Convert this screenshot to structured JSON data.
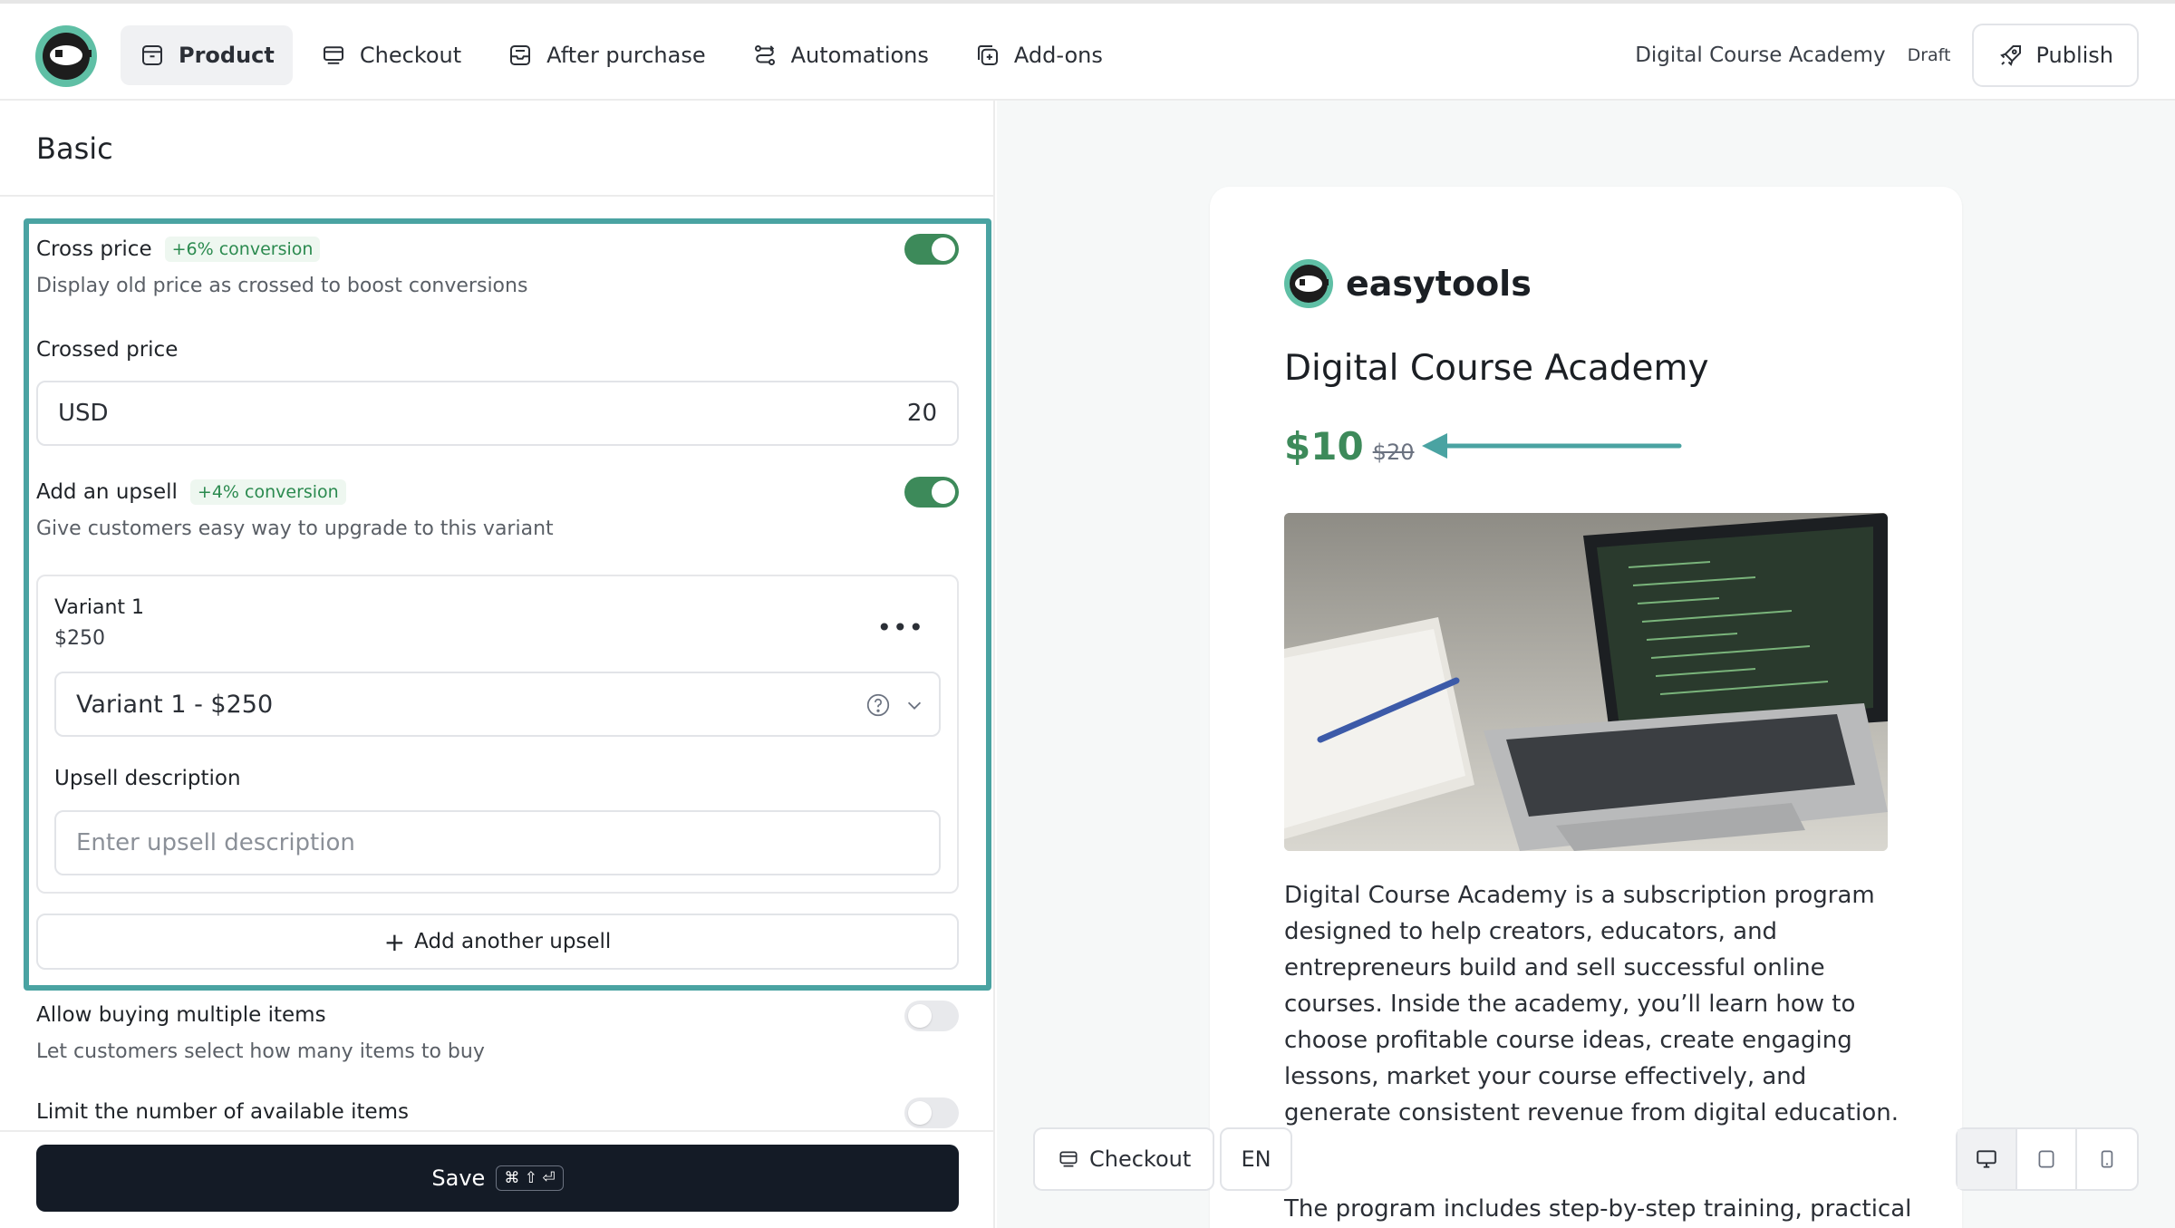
{
  "nav": {
    "items": [
      {
        "label": "Product",
        "icon": "box-icon"
      },
      {
        "label": "Checkout",
        "icon": "checkout-icon"
      },
      {
        "label": "After purchase",
        "icon": "inbox-icon"
      },
      {
        "label": "Automations",
        "icon": "route-icon"
      },
      {
        "label": "Add-ons",
        "icon": "plus-box-icon"
      }
    ],
    "product_name": "Digital Course Academy",
    "status": "Draft",
    "publish_label": "Publish"
  },
  "panel": {
    "title": "Basic",
    "cross_price": {
      "title": "Cross price",
      "badge": "+6% conversion",
      "description": "Display old price as crossed to boost conversions",
      "enabled": true
    },
    "crossed_price": {
      "label": "Crossed price",
      "currency": "USD",
      "amount": "20"
    },
    "upsell": {
      "title": "Add an upsell",
      "badge": "+4% conversion",
      "description": "Give customers easy way to upgrade to this variant",
      "enabled": true,
      "variant_title": "Variant 1",
      "variant_price": "$250",
      "selected_variant": "Variant 1 - $250",
      "description_label": "Upsell description",
      "description_placeholder": "Enter upsell description",
      "add_another_label": "Add another upsell"
    },
    "multiple_items": {
      "title": "Allow buying multiple items",
      "description": "Let customers select how many items to buy",
      "enabled": false
    },
    "limit_items": {
      "title": "Limit the number of available items",
      "enabled": false
    },
    "save_label": "Save",
    "save_shortcut": "⌘ ⇧ ⏎"
  },
  "preview": {
    "brand": "easytools",
    "title": "Digital Course Academy",
    "price": "$10",
    "old_price": "$20",
    "description": "Digital Course Academy is a subscription program designed to help creators, educators, and entrepreneurs build and sell successful online courses. Inside the academy, you’ll learn how to choose profitable course ideas, create engaging lessons, market your course effectively, and generate consistent revenue from digital education.",
    "description_more": "The program includes step-by-step training, practical",
    "checkout_label": "Checkout",
    "language": "EN",
    "accent_color": "#3d8a5a",
    "highlight_color": "#4aa3a2"
  }
}
